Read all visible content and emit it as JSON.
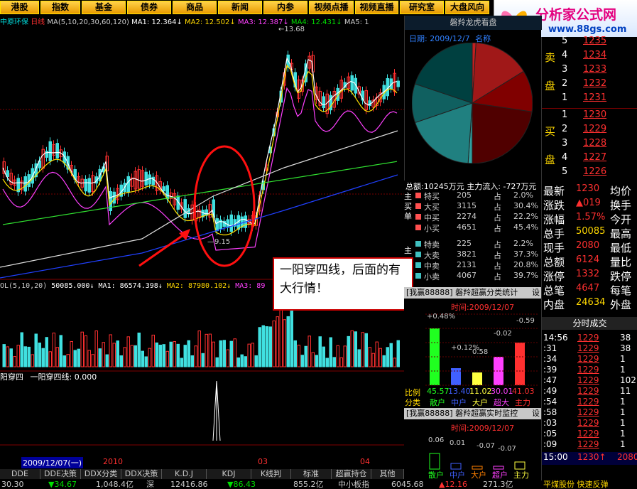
{
  "nav": [
    "港股",
    "指数",
    "基金",
    "债券",
    "商品",
    "新闻",
    "内参",
    "视频点播",
    "视频直播",
    "研究室",
    "大盘风向"
  ],
  "logo": {
    "brand": "分析家公式网",
    "url": "www.88gs.com"
  },
  "chart_header": {
    "stock": "中原环保",
    "period": "日线",
    "ma_def": "MA(5,10,20,30,60,120)",
    "ma1": "MA1: 12.364↓",
    "ma2": "MA2: 12.502↓",
    "ma3": "MA3: 12.387↓",
    "ma4": "MA4: 12.431↓",
    "ma5": "MA5: 1"
  },
  "price_labels": {
    "high": "13.68",
    "low": "9.15"
  },
  "volume_header": {
    "vol": "OL(5,10,20)",
    "value": "50085.000↓",
    "ma1": "MA1: 86574.398↓",
    "ma2": "MA2: 87980.102↓",
    "ma3": "MA3: 89"
  },
  "indicator_header": {
    "name": "阳穿四",
    "label": "一阳穿四线: 0.000"
  },
  "date_axis": {
    "cursor": "2009/12/07(一)",
    "year": "2010",
    "m3": "03",
    "m4": "04"
  },
  "annotation": "一阳穿四线，后面的有大行情！",
  "bottom_tabs": [
    "DDE",
    "DDE决策",
    "DDX分类",
    "DDX决策",
    "K.D.J",
    "KDJ",
    "K线判",
    "标准",
    "超赢持仓",
    "其他"
  ],
  "status": {
    "s1": "30.30",
    "s2": "▼34.67",
    "s3": "1,048.4亿",
    "s4": "深",
    "s5": "12416.86",
    "s6": "▼86.43",
    "s7": "855.2亿",
    "s8": "中小板指",
    "s9": "6045.68",
    "s10": "▲12.16",
    "s11": "271.3亿",
    "s12": "平煤股份 快速反弹"
  },
  "right_panel": {
    "pie_title": "磐羚龙虎看盘",
    "pie_date": "日期: 2009/12/7",
    "pie_name": "名称",
    "flow_line": "总额:10245万元  主力流入: -727万元",
    "buy_side": "主买单",
    "sell_side": "主",
    "buys": [
      [
        "特买",
        "205",
        "占",
        "2.0%"
      ],
      [
        "大买",
        "3115",
        "占",
        "30.4%"
      ],
      [
        "中买",
        "2274",
        "占",
        "22.2%"
      ],
      [
        "小买",
        "4651",
        "占",
        "45.4%"
      ]
    ],
    "sells": [
      [
        "特卖",
        "225",
        "占",
        "2.2%"
      ],
      [
        "大卖",
        "3821",
        "占",
        "37.3%"
      ],
      [
        "中卖",
        "2131",
        "占",
        "20.8%"
      ],
      [
        "小卖",
        "4067",
        "占",
        "39.7%"
      ]
    ],
    "bar1_title": "[我赢88888] 磐羚超赢分类统计",
    "bar1_set": "设",
    "bar1_date": "时间:2009/12/07",
    "bar1_ratio": "比例",
    "bar1_cls": "分类",
    "bar1_labels": [
      "散户",
      "中户",
      "大户",
      "超大",
      "主力"
    ],
    "bar1_vals": [
      "45.57",
      "13.40",
      "11.02",
      "30.01",
      "41.03"
    ],
    "bar1_pcts": [
      "+0.48%",
      "+0.12%",
      "0.58",
      "-0.02",
      "-0.59"
    ],
    "bar2_title": "[我赢88888] 磐羚超赢实时监控",
    "bar2_set": "设",
    "bar2_date": "时间:2009/12/07",
    "bar2_vals": [
      "0.06",
      "0.01",
      "-0.07",
      "-0.07"
    ],
    "bar2_labels": [
      "散户",
      "中户",
      "大户",
      "超户",
      "主力"
    ]
  },
  "orderbook": {
    "sell_side": "卖",
    "sell_side2": "盘",
    "buy_side": "买",
    "buy_side2": "盘",
    "sells": [
      [
        "5",
        "1235"
      ],
      [
        "4",
        "1234"
      ],
      [
        "3",
        "1233"
      ],
      [
        "2",
        "1232"
      ],
      [
        "1",
        "1231"
      ]
    ],
    "buys": [
      [
        "1",
        "1230"
      ],
      [
        "2",
        "1229"
      ],
      [
        "3",
        "1228"
      ],
      [
        "4",
        "1227"
      ],
      [
        "5",
        "1226"
      ]
    ],
    "quote": [
      [
        "最新",
        "1230",
        "均价",
        ""
      ],
      [
        "涨跌",
        "▲019",
        "换手",
        ""
      ],
      [
        "涨幅",
        "1.57%",
        "今开",
        ""
      ],
      [
        "总手",
        "50085",
        "最高",
        ""
      ],
      [
        "现手",
        "2080",
        "最低",
        ""
      ],
      [
        "总额",
        "6124",
        "量比",
        ""
      ],
      [
        "涨停",
        "1332",
        "跌停",
        ""
      ],
      [
        "总笔",
        "4647",
        "每笔",
        ""
      ],
      [
        "内盘",
        "24634",
        "外盘",
        ""
      ]
    ],
    "ticks_title": "分时成交",
    "ticks": [
      [
        "14:56",
        "1229",
        "38"
      ],
      [
        ":31",
        "1229",
        "38"
      ],
      [
        ":34",
        "1229",
        "1"
      ],
      [
        ":39",
        "1229",
        "1"
      ],
      [
        ":47",
        "1229",
        "102"
      ],
      [
        ":49",
        "1229",
        "11"
      ],
      [
        ":54",
        "1229",
        "1"
      ],
      [
        ":58",
        "1229",
        "1"
      ],
      [
        ":03",
        "1229",
        "1"
      ],
      [
        ":05",
        "1229",
        "1"
      ],
      [
        ":09",
        "1229",
        "1"
      ]
    ],
    "last_tick": [
      "15:00",
      "1230↑",
      "2080"
    ]
  }
}
